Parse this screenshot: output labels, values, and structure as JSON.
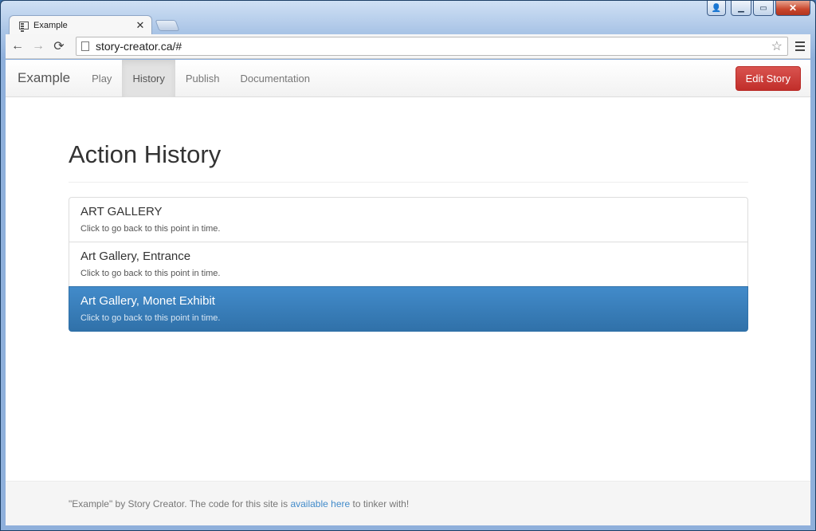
{
  "browser": {
    "tab": {
      "title": "Example",
      "close_glyph": "✕"
    },
    "window_controls": {
      "user": "👤",
      "minimize": "▁",
      "maximize": "▭",
      "close": "✕"
    },
    "nav": {
      "back": "←",
      "forward": "→",
      "reload": "⟳"
    },
    "url": "story-creator.ca/#",
    "star": "☆"
  },
  "navbar": {
    "brand": "Example",
    "links": [
      {
        "label": "Play",
        "active": false
      },
      {
        "label": "History",
        "active": true
      },
      {
        "label": "Publish",
        "active": false
      },
      {
        "label": "Documentation",
        "active": false
      }
    ],
    "edit_button": "Edit Story"
  },
  "main": {
    "title": "Action History",
    "history": [
      {
        "heading": "ART GALLERY",
        "text": "Click to go back to this point in time.",
        "active": false
      },
      {
        "heading": "Art Gallery, Entrance",
        "text": "Click to go back to this point in time.",
        "active": false
      },
      {
        "heading": "Art Gallery, Monet Exhibit",
        "text": "Click to go back to this point in time.",
        "active": true
      }
    ]
  },
  "footer": {
    "prefix": "\"Example\" by Story Creator. The code for this site is ",
    "link": "available here",
    "suffix": " to tinker with!"
  },
  "colors": {
    "primary": "#428bca",
    "danger": "#d9534f",
    "footer_bg": "#f5f5f5"
  }
}
